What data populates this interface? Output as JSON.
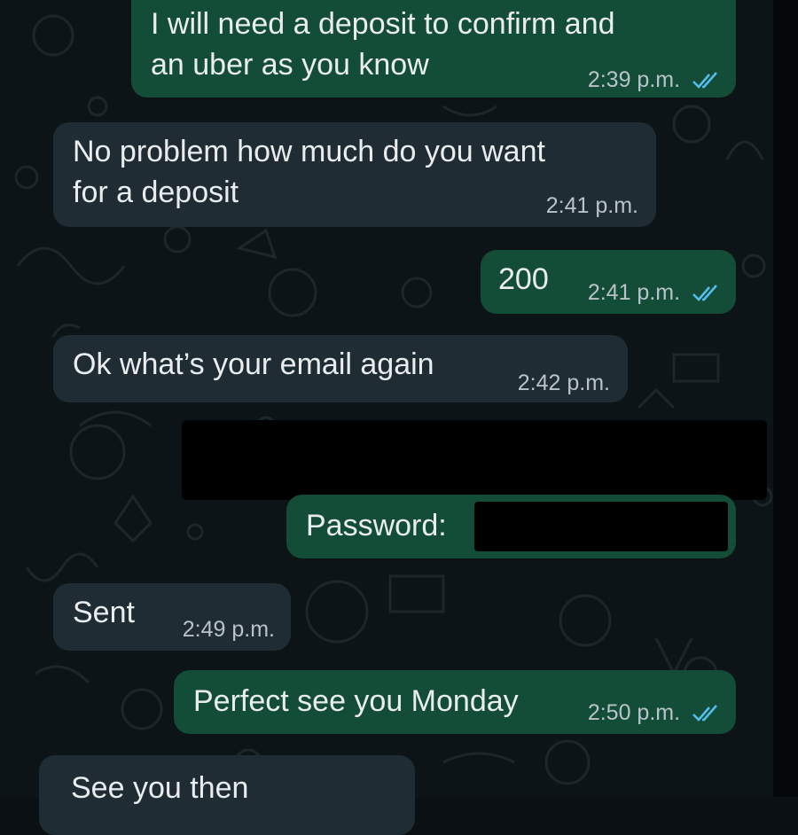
{
  "chat": {
    "messages": [
      {
        "id": "m1",
        "direction": "outgoing",
        "text": "I will need a deposit to confirm and\nan uber as you know",
        "time": "2:39 p.m.",
        "read": true
      },
      {
        "id": "m2",
        "direction": "incoming",
        "text": "No problem how much do you want\nfor a deposit",
        "time": "2:41 p.m."
      },
      {
        "id": "m3",
        "direction": "outgoing",
        "text": "200",
        "time": "2:41 p.m.",
        "read": true
      },
      {
        "id": "m4",
        "direction": "incoming",
        "text": "Ok what’s your email again",
        "time": "2:42 p.m."
      },
      {
        "id": "m5",
        "direction": "outgoing",
        "text": "",
        "redacted": true
      },
      {
        "id": "m6",
        "direction": "outgoing",
        "text": "Password:",
        "redacted": true
      },
      {
        "id": "m7",
        "direction": "incoming",
        "text": "Sent",
        "time": "2:49 p.m."
      },
      {
        "id": "m8",
        "direction": "outgoing",
        "text": "Perfect see you Monday",
        "time": "2:50 p.m.",
        "read": true
      },
      {
        "id": "m9",
        "direction": "incoming",
        "text": "See you then",
        "time": ""
      }
    ]
  },
  "colors": {
    "outgoing_bubble": "#144d37",
    "incoming_bubble": "#202c33",
    "read_ticks": "#53bdeb",
    "background": "#0d1418"
  },
  "icons": {
    "read_receipt": "double-check-icon"
  }
}
